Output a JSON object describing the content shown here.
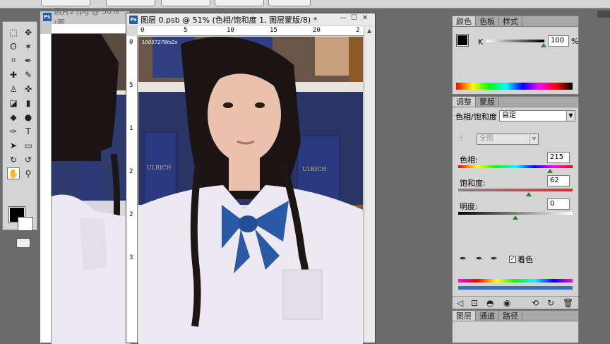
{
  "option_bar": {
    "btn1": "",
    "btn2": "",
    "btn3": "",
    "btn4": ""
  },
  "toolbox": {
    "tools": [
      "marquee-tool",
      "move-tool",
      "lasso-tool",
      "magic-wand-tool",
      "crop-tool",
      "eyedropper-tool",
      "healing-brush-tool",
      "brush-tool",
      "clone-stamp-tool",
      "history-brush-tool",
      "eraser-tool",
      "gradient-tool",
      "blur-tool",
      "dodge-tool",
      "pen-tool",
      "type-tool",
      "path-selection-tool",
      "shape-tool",
      "3d-rotate-tool",
      "3d-orbit-tool",
      "hand-tool",
      "zoom-tool"
    ],
    "glyphs": [
      "⬚",
      "✥",
      "ʘ",
      "✶",
      "⌗",
      "✒",
      "✚",
      "✎",
      "♙",
      "✜",
      "◪",
      "▮",
      "◆",
      "●",
      "✑",
      "T",
      "➤",
      "▭",
      "↻",
      "↺",
      "✋",
      "⚲"
    ],
    "active": "hand-tool"
  },
  "doc1": {
    "title": "照片2.jpg @ 50% (图"
  },
  "doc2": {
    "title": "图层 0.psb @ 51% (色相/饱和度 1, 图层蒙版/8) *",
    "ruler_h": [
      "0",
      "5",
      "10",
      "15",
      "20",
      "2"
    ],
    "ruler_v": [
      "0",
      "5",
      "1",
      "2",
      "2",
      "3"
    ],
    "photo_watermark": "10057278ts2s"
  },
  "color_panel": {
    "tabs": [
      "颜色",
      "色板",
      "样式"
    ],
    "channel_label": "K",
    "value": "100",
    "unit": "%"
  },
  "adjust_panel": {
    "tabs": [
      "调整",
      "蒙版"
    ],
    "title": "色相/饱和度",
    "preset": "自定",
    "range": "全图",
    "hue_label": "色相:",
    "hue_value": "215",
    "hue_level": 0.8,
    "sat_label": "饱和度:",
    "sat_value": "62",
    "sat_level": 0.62,
    "light_label": "明度:",
    "light_value": "0",
    "light_level": 0.5,
    "colorize_label": "着色",
    "colorize_checked": true
  },
  "layers_panel": {
    "tabs": [
      "图层",
      "通道",
      "路径"
    ]
  },
  "colors": {
    "shirt": "#ece9f1",
    "bow": "#2a5aa6",
    "hair": "#1a1414",
    "skin": "#e9c1ad",
    "shelf_books": "#2c3f79"
  }
}
